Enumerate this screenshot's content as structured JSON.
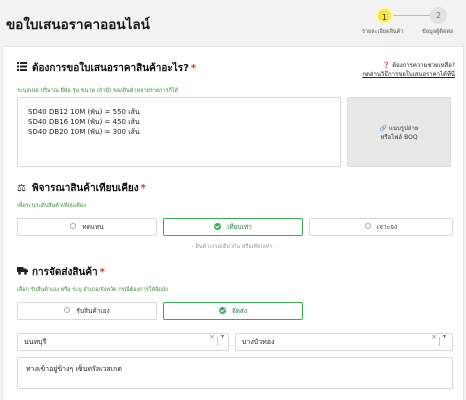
{
  "header": {
    "title": "ขอใบเสนอราคาออนไลน์",
    "steps": [
      {
        "number": "1",
        "label": "รายละเอียดสินค้า"
      },
      {
        "number": "2",
        "label": "ข้อมูลผู้ติดต่อ"
      }
    ]
  },
  "requirements": {
    "title": "ต้องการขอใบเสนอราคาสินค้าอะไร?",
    "hint": "ระบุสเปค ปริมาณ ยี่ห้อ รุ่น ขนาด (ถ้ามี) ของสินค้าหลายรายการก็ได้",
    "help_question": "ต้องการความช่วยเหลือ?",
    "help_link": "กดอ่านวิธีการขอใบเสนอราคาได้ที่นี่",
    "lines": [
      "SD40 DB12 10M (พัน) = 550 เส้น",
      "SD40 DB16 10M (พัน) = 450 เส้น",
      "SD40 DB20 10M (พัน) = 300 เส้น"
    ],
    "upload_line1": "แนบรูปถ่าย",
    "upload_line2": "หรือไฟล์ BOQ"
  },
  "comparison": {
    "title": "พิจารณาสินค้าเทียบเคียง",
    "hint": "เพื่อระบุระดับสินค้าเทียบเคียง",
    "options": [
      "ทดแทน",
      "เทียบเท่า",
      "เจาะจง"
    ],
    "selected": "เทียบเท่า",
    "note": "- สินค้าเกรดเดียวกัน หรือเทียบเท่า -"
  },
  "delivery": {
    "title": "การจัดส่งสินค้า",
    "hint": "เลือก รับสินค้าเอง หรือ ระบุ อำเภอ/จังหวัด กรณีต้องการให้จัดส่ง",
    "options": [
      "รับสินค้าเอง",
      "จัดส่ง"
    ],
    "selected": "จัดส่ง",
    "province": "นนทบุรี",
    "district": "บางบัวทอง",
    "address": "ทางเข้าอยู่ข้างๆ เซ็นทรัลเวสเกต"
  },
  "colors": {
    "accent": "#3cab55",
    "required": "#d8362a",
    "step_active": "#f5e54a"
  }
}
